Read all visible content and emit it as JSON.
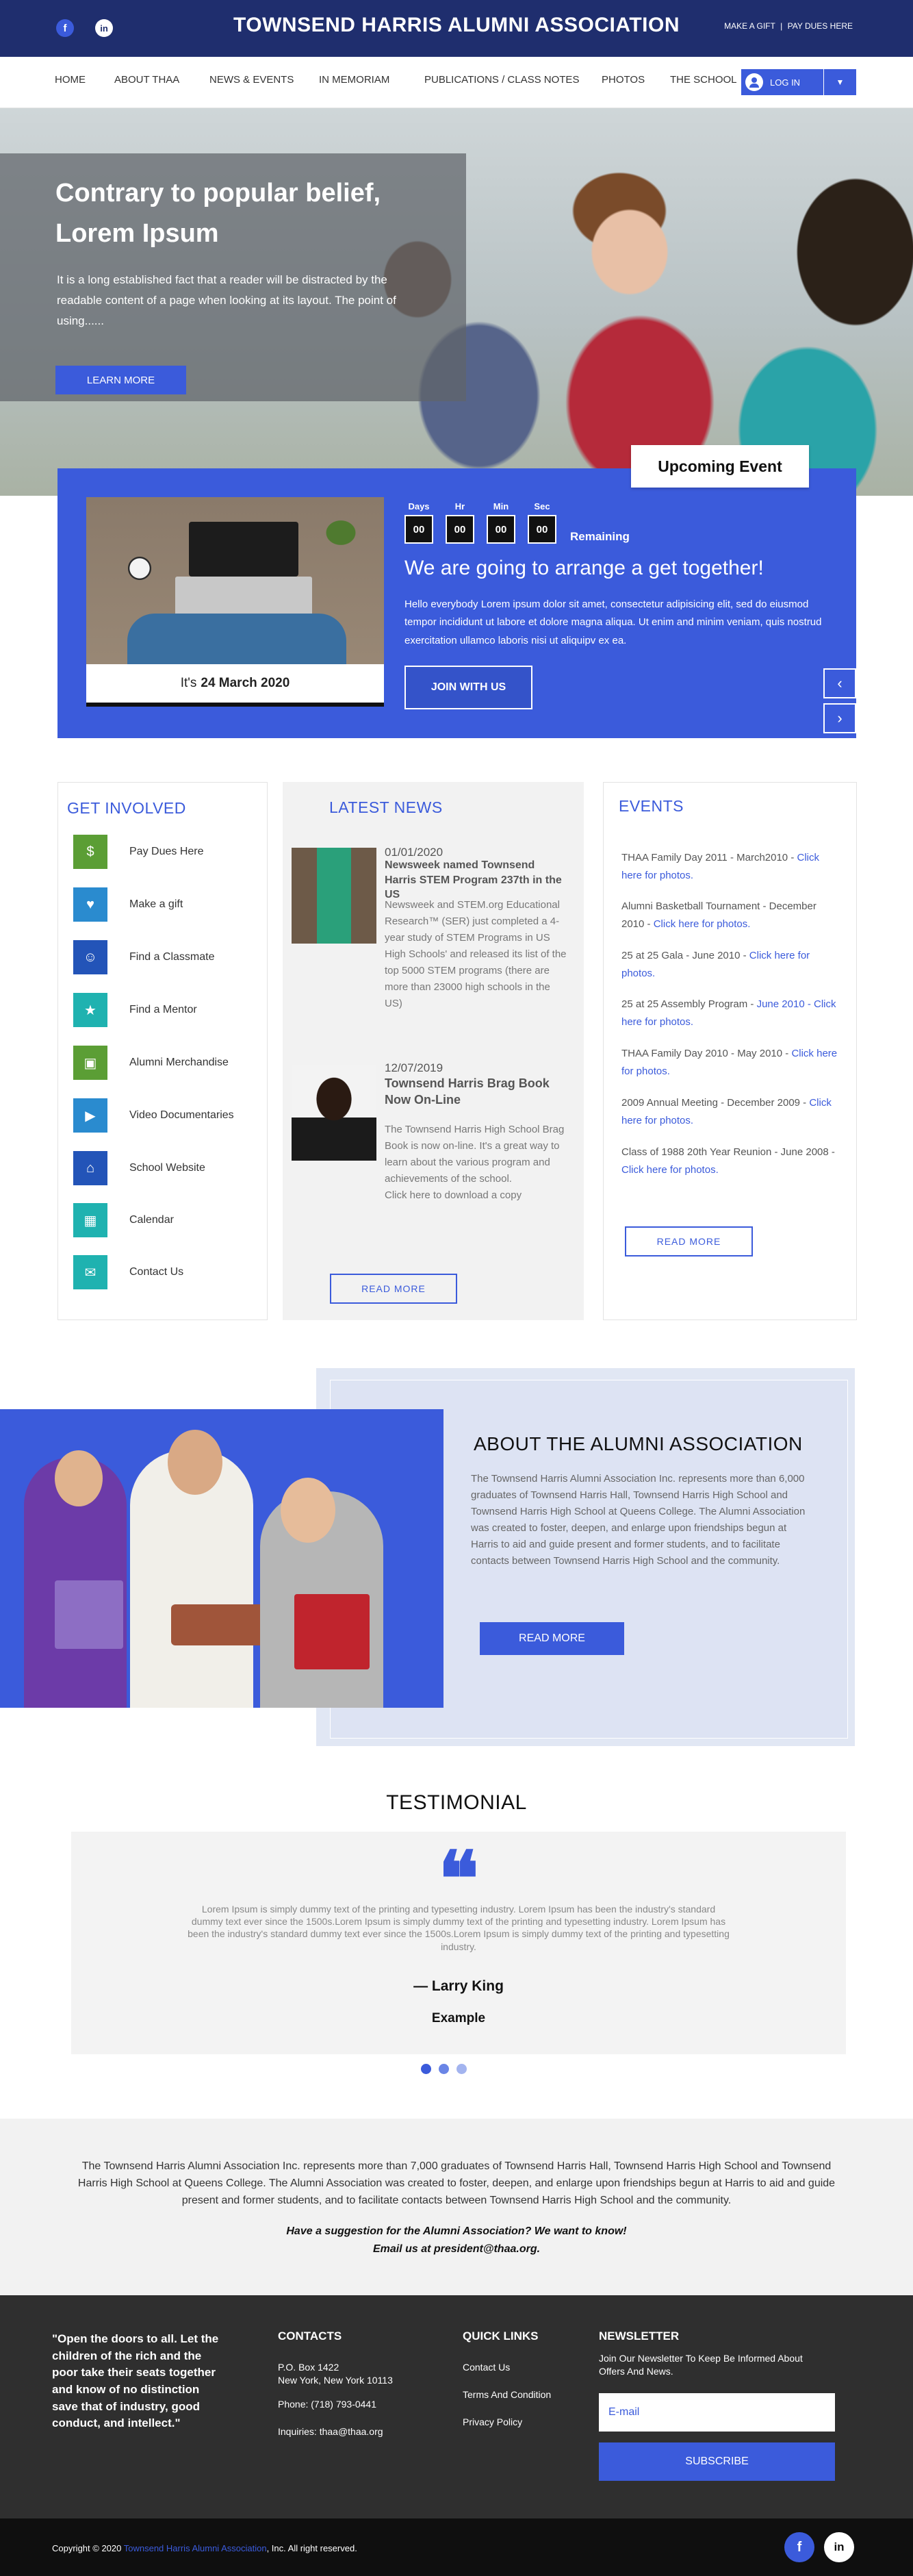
{
  "topbar": {
    "title": "TOWNSEND HARRIS ALUMNI ASSOCIATION",
    "facebook_icon": "f",
    "linkedin_icon": "in",
    "link_gift": "MAKE A GIFT",
    "separator": "|",
    "link_dues": "PAY DUES HERE"
  },
  "nav": {
    "items": [
      "HOME",
      "ABOUT THAA",
      "NEWS & EVENTS",
      "IN MEMORIAM",
      "PUBLICATIONS / CLASS NOTES",
      "PHOTOS",
      "THE SCHOOL"
    ],
    "login_label": "LOG IN",
    "caret": "▼"
  },
  "hero": {
    "heading": "Contrary to popular belief, Lorem Ipsum",
    "text": "It is a long established fact that a reader will be distracted by the readable content of a page when looking at its layout. The point of using......",
    "button": "LEARN MORE"
  },
  "event": {
    "tag": "Upcoming Event",
    "date_prefix": "It's",
    "date": "24 March 2020",
    "countdown": [
      {
        "label": "Days",
        "value": "00"
      },
      {
        "label": "Hr",
        "value": "00"
      },
      {
        "label": "Min",
        "value": "00"
      },
      {
        "label": "Sec",
        "value": "00"
      }
    ],
    "remaining": "Remaining",
    "heading": "We are going to arrange a get together!",
    "description": "Hello everybody Lorem ipsum dolor sit amet, consectetur adipisicing elit, sed do eiusmod tempor incididunt ut labore et dolore magna aliqua. Ut enim and minim veniam, quis nostrud exercitation ullamco laboris nisi ut aliquipv ex ea.",
    "join_button": "JOIN WITH US",
    "prev": "‹",
    "next": "›"
  },
  "get_involved": {
    "title": "GET INVOLVED",
    "items": [
      {
        "label": "Pay Dues Here",
        "color": "#5b9e35",
        "icon": "$"
      },
      {
        "label": "Make a gift",
        "color": "#2a8bcf",
        "icon": "♥"
      },
      {
        "label": "Find a Classmate",
        "color": "#2354b8",
        "icon": "☺"
      },
      {
        "label": "Find a Mentor",
        "color": "#1fb2b0",
        "icon": "★"
      },
      {
        "label": "Alumni Merchandise",
        "color": "#5b9e35",
        "icon": "▣"
      },
      {
        "label": "Video Documentaries",
        "color": "#2a8bcf",
        "icon": "▶"
      },
      {
        "label": "School Website",
        "color": "#2354b8",
        "icon": "⌂"
      },
      {
        "label": "Calendar",
        "color": "#1fb2b0",
        "icon": "▦"
      },
      {
        "label": "Contact Us",
        "color": "#1fb2b0",
        "icon": "✉"
      }
    ]
  },
  "latest_news": {
    "title": "LATEST NEWS",
    "items": [
      {
        "date": "01/01/2020",
        "title": "Newsweek named Townsend Harris STEM Program 237th in the US",
        "body": "Newsweek and STEM.org Educational Research™ (SER) just completed a 4-year study of STEM Programs in US High Schools' and released its list of the top 5000 STEM programs (there are more than 23000 high schools in the US)"
      },
      {
        "date": "12/07/2019",
        "title": "Townsend Harris Brag Book Now On-Line",
        "body": "The Townsend Harris High School Brag Book is now on-line. It's a great way to learn about the various program and achievements of the school.",
        "extra": "Click here to download a copy"
      }
    ],
    "button": "READ MORE"
  },
  "events": {
    "title": "EVENTS",
    "items": [
      {
        "text": "THAA Family Day 2011 - March2010 - ",
        "link": "Click here for photos."
      },
      {
        "text": "Alumni Basketball Tournament - December 2010 - ",
        "link": "Click here for photos."
      },
      {
        "text": "25 at 25 Gala - June 2010 - ",
        "link": "Click here for photos."
      },
      {
        "text": "25 at 25 Assembly Program - ",
        "link": "June 2010 - Click here for photos."
      },
      {
        "text": "THAA Family Day 2010 - May 2010 - ",
        "link": "Click here for photos."
      },
      {
        "text": "2009 Annual Meeting - December 2009 - ",
        "link": "Click here for photos."
      },
      {
        "text": "Class of 1988 20th Year Reunion - June 2008 - ",
        "link": "Click here for photos."
      }
    ],
    "button": "READ MORE"
  },
  "about": {
    "title": "ABOUT THE ALUMNI ASSOCIATION",
    "text": "The Townsend Harris Alumni Association Inc. represents more than 6,000 graduates of Townsend Harris Hall, Townsend Harris High School and Townsend Harris High School at Queens College. The Alumni Association was created to foster, deepen, and enlarge upon friendships begun at Harris to aid and guide present and former students, and to facilitate contacts between Townsend Harris High School and the community.",
    "button": "READ MORE"
  },
  "testimonial": {
    "title": "TESTIMONIAL",
    "quote_icon": "❝",
    "text": "Lorem Ipsum is simply dummy text of the printing and typesetting industry. Lorem Ipsum has been the industry's standard dummy text ever since the 1500s.Lorem Ipsum is simply dummy text of the printing and typesetting industry. Lorem Ipsum has been the industry's standard dummy text ever since the 1500s.Lorem Ipsum is simply dummy text of the printing and typesetting industry.",
    "name": "— Larry King",
    "role": "Example"
  },
  "strip": {
    "text": "The Townsend Harris Alumni Association Inc. represents more than 7,000 graduates of Townsend Harris Hall, Townsend Harris High School and Townsend Harris High School at Queens College. The Alumni Association was created to foster, deepen, and enlarge upon friendships begun at Harris to aid and guide present and former students, and to facilitate contacts between Townsend Harris High School and the community.",
    "suggestion_line1": "Have a suggestion for the Alumni Association? We want to know!",
    "suggestion_line2": "Email us at president@thaa.org."
  },
  "footer": {
    "quote": "\"Open the doors to all. Let the children of the rich and the poor take their seats together and know of no distinction save that of industry, good conduct, and intellect.\"",
    "contacts_title": "CONTACTS",
    "address_line1": "P.O. Box 1422",
    "address_line2": "New York, New York 10113",
    "phone": "Phone: (718) 793-0441",
    "inquiries": "Inquiries: thaa@thaa.org",
    "quick_title": "QUICK LINKS",
    "quick_links": [
      "Contact Us",
      "Terms And Condition",
      "Privacy Policy"
    ],
    "newsletter_title": "NEWSLETTER",
    "newsletter_text": "Join Our Newsletter To Keep Be Informed About Offers And News.",
    "email_placeholder": "E-mail",
    "subscribe": "SUBSCRIBE"
  },
  "bottom": {
    "copy_prefix": "Copyright © 2020 ",
    "copy_brand": "Townsend Harris Alumni Association",
    "copy_suffix": ", Inc. All right reserved.",
    "facebook_icon": "f",
    "linkedin_icon": "in"
  },
  "colors": {
    "primary": "#3b5bdb",
    "topbar": "#1f2e6e",
    "footer": "#2f2f2f"
  }
}
